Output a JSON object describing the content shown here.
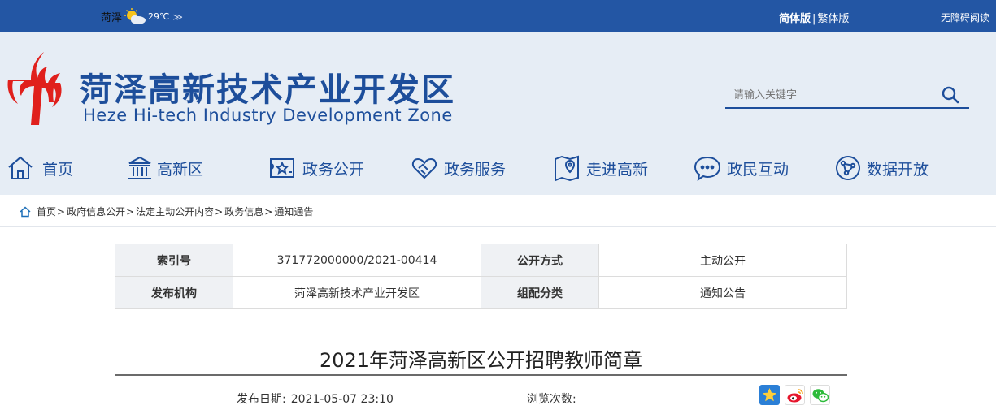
{
  "colors": {
    "brand": "#1d4e9b",
    "topbar": "#2356a4",
    "header_bg": "#e6edf5",
    "logo_red": "#e0201c"
  },
  "topbar": {
    "weather_city": "菏泽",
    "weather_icon": "sun-cloud-icon",
    "weather_temp": "29℃",
    "weather_more": "≫",
    "lang_simplified": "简体版",
    "lang_sep": "|",
    "lang_traditional": "繁体版",
    "accessibility": "无障碍阅读"
  },
  "header": {
    "title": "菏泽高新技术产业开发区",
    "subtitle": "Heze Hi-tech Industry Development Zone",
    "search_placeholder": "请输入关键字"
  },
  "nav": [
    {
      "label": "首页",
      "icon": "home-icon"
    },
    {
      "label": "高新区",
      "icon": "building-icon"
    },
    {
      "label": "政务公开",
      "icon": "star-card-icon"
    },
    {
      "label": "政务服务",
      "icon": "handshake-icon"
    },
    {
      "label": "走进高新",
      "icon": "map-pin-icon"
    },
    {
      "label": "政民互动",
      "icon": "chat-icon"
    },
    {
      "label": "数据开放",
      "icon": "network-icon"
    }
  ],
  "breadcrumb": [
    "首页",
    "政府信息公开",
    "法定主动公开内容",
    "政务信息",
    "通知通告"
  ],
  "info": {
    "index_label": "索引号",
    "index_value": "371772000000/2021-00414",
    "method_label": "公开方式",
    "method_value": "主动公开",
    "org_label": "发布机构",
    "org_value": "菏泽高新技术产业开发区",
    "category_label": "组配分类",
    "category_value": "通知公告"
  },
  "article": {
    "title": "2021年菏泽高新区公开招聘教师简章",
    "date_label": "发布日期:",
    "date_value": "2021-05-07 23:10",
    "views_label": "浏览次数:",
    "views_value": ""
  },
  "share": [
    "qzone-icon",
    "weibo-icon",
    "wechat-icon"
  ]
}
